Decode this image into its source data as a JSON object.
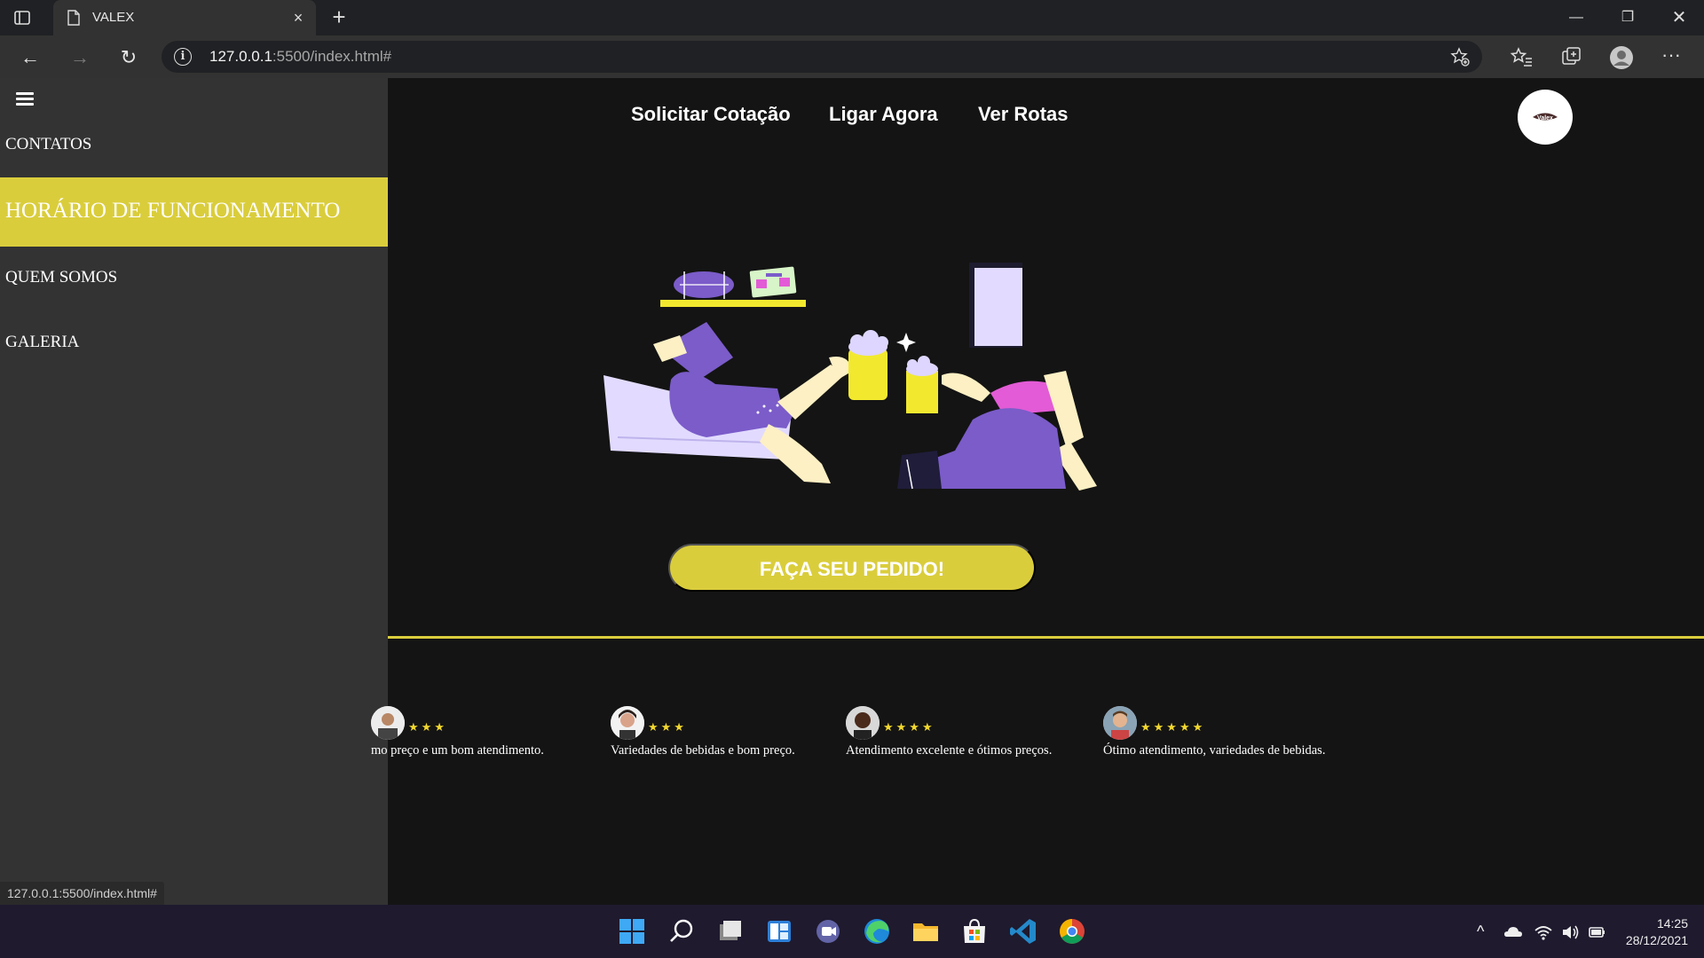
{
  "browser": {
    "tab_title": "VALEX",
    "url_host": "127.0.0.1",
    "url_rest": ":5500/index.html#",
    "status_url": "127.0.0.1:5500/index.html#"
  },
  "sidebar": {
    "items": [
      {
        "label": "CONTATOS",
        "active": false
      },
      {
        "label": "HORÁRIO DE FUNCIONAMENTO",
        "active": true
      },
      {
        "label": "QUEM SOMOS",
        "active": false
      },
      {
        "label": "GALERIA",
        "active": false
      }
    ]
  },
  "topnav": {
    "links": [
      "Solicitar Cotação",
      "Ligar Agora",
      "Ver Rotas"
    ]
  },
  "logo": {
    "text": "Valex"
  },
  "cta": {
    "label": "FAÇA SEU PEDIDO!"
  },
  "reviews": [
    {
      "stars": 3,
      "text": "mo preço e um bom atendimento."
    },
    {
      "stars": 3,
      "text": "Variedades de bebidas e bom preço."
    },
    {
      "stars": 4,
      "text": "Atendimento excelente e ótimos preços."
    },
    {
      "stars": 5,
      "text": "Ótimo atendimento, variedades de bebidas."
    }
  ],
  "taskbar": {
    "time": "14:25",
    "date": "28/12/2021",
    "apps": [
      "windows-start",
      "search",
      "task-view",
      "widgets",
      "teams-chat",
      "edge",
      "file-explorer",
      "microsoft-store",
      "vscode",
      "chrome"
    ]
  },
  "colors": {
    "accent": "#dacd3c",
    "sidebar_bg": "#333333",
    "page_bg": "#141414",
    "illustration_purple": "#7b5cc9",
    "star": "#f2d82f"
  }
}
